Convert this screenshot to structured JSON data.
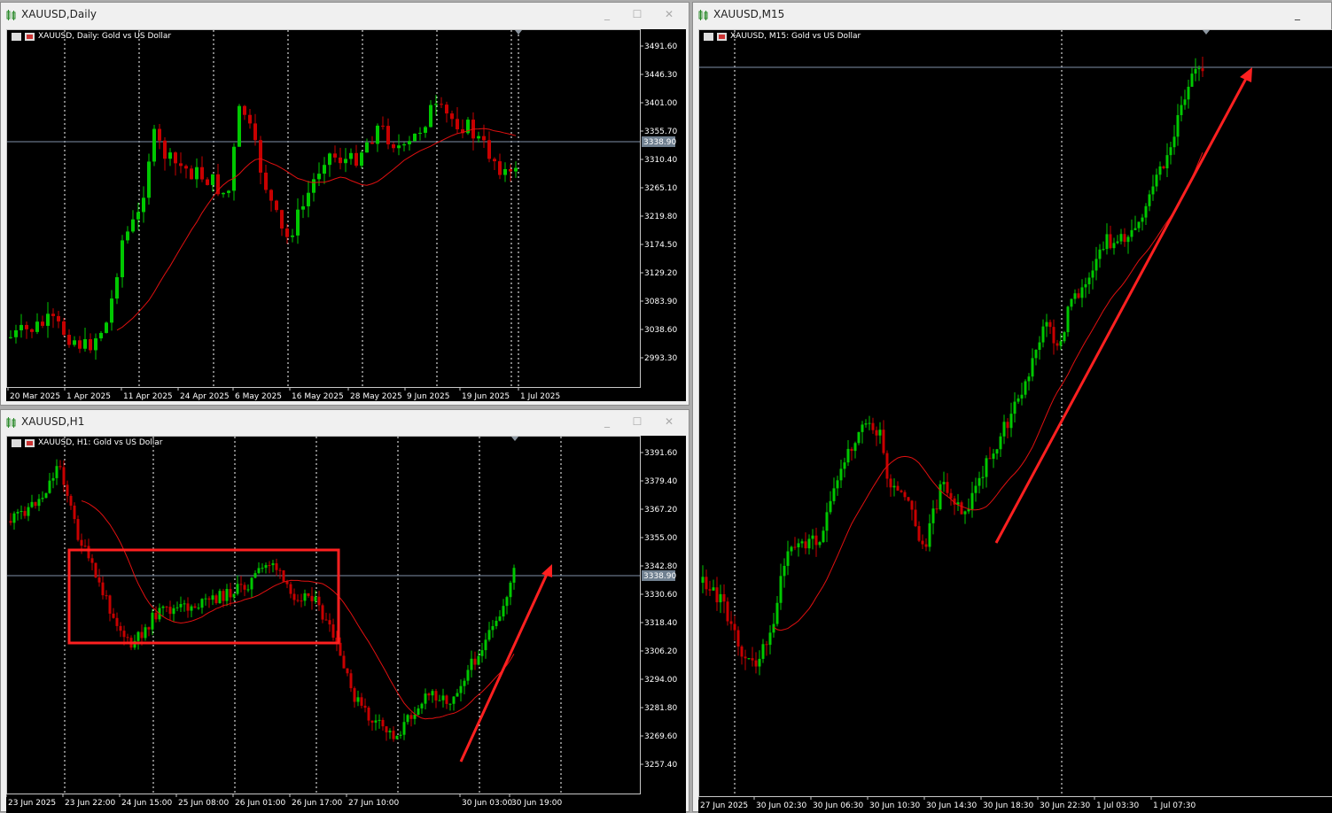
{
  "windows": [
    {
      "id": "daily",
      "title": "XAUUSD,Daily",
      "info": "XAUUSD, Daily:  Gold vs US Dollar",
      "price_labels": [
        "3491.60",
        "3446.30",
        "3401.00",
        "3355.70",
        "3310.40",
        "3265.10",
        "3219.80",
        "3174.50",
        "3129.20",
        "3083.90",
        "3038.60",
        "2993.30"
      ],
      "current_price": "3338.90",
      "time_labels": [
        "20 Mar 2025",
        "1 Apr 2025",
        "11 Apr 2025",
        "24 Apr 2025",
        "6 May 2025",
        "16 May 2025",
        "28 May 2025",
        "9 Jun 2025",
        "19 Jun 2025",
        "1 Jul 2025"
      ]
    },
    {
      "id": "h1",
      "title": "XAUUSD,H1",
      "info": "XAUUSD, H1:  Gold vs US Dollar",
      "price_labels": [
        "3391.60",
        "3379.40",
        "3367.20",
        "3355.00",
        "3342.80",
        "3330.60",
        "3318.40",
        "3306.20",
        "3294.00",
        "3281.80",
        "3269.60",
        "3257.40"
      ],
      "current_price": "3338.90",
      "time_labels": [
        "23 Jun 2025",
        "23 Jun 22:00",
        "24 Jun 15:00",
        "25 Jun 08:00",
        "26 Jun 01:00",
        "26 Jun 17:00",
        "27 Jun 10:00",
        "30 Jun 03:00",
        "30 Jun 19:00"
      ]
    },
    {
      "id": "m15",
      "title": "XAUUSD,M15",
      "info": "XAUUSD, M15:  Gold vs US Dollar",
      "price_labels": [],
      "current_price": "",
      "time_labels": [
        "27 Jun 2025",
        "30 Jun 02:30",
        "30 Jun 06:30",
        "30 Jun 10:30",
        "30 Jun 14:30",
        "30 Jun 18:30",
        "30 Jun 22:30",
        "1 Jul 03:30",
        "1 Jul 07:30"
      ]
    }
  ],
  "window_controls": {
    "minimize": "_",
    "maximize": "☐",
    "close": "✕"
  },
  "colors": {
    "bull": "#00c800",
    "bear": "#c80000",
    "ma": "#e01010",
    "annotation": "#ff2020",
    "grid": "#ffffff",
    "bid_line": "#8090a8"
  }
}
